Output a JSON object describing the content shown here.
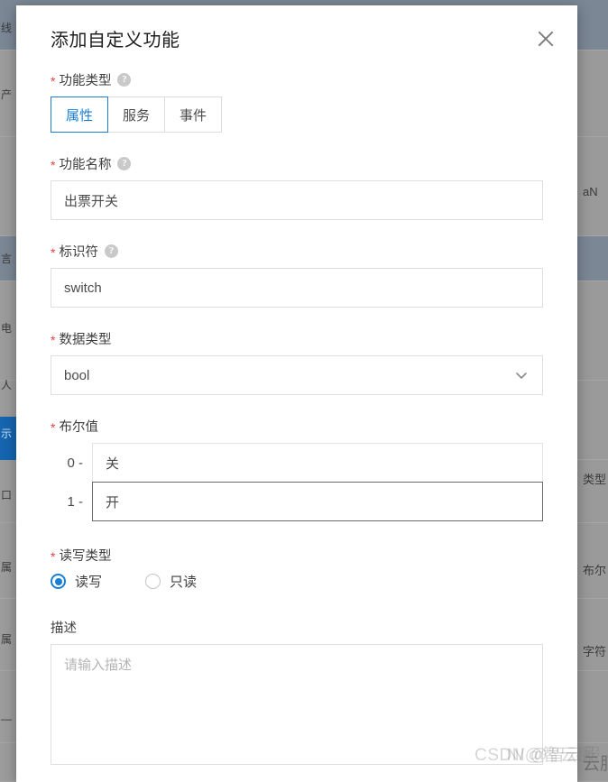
{
  "dialog": {
    "title": "添加自定义功能",
    "close_label": "×"
  },
  "fields": {
    "function_type": {
      "label": "功能类型",
      "required": true,
      "help": "?",
      "options": [
        "属性",
        "服务",
        "事件"
      ],
      "selected": "属性"
    },
    "function_name": {
      "label": "功能名称",
      "required": true,
      "help": "?",
      "value": "出票开关",
      "placeholder": ""
    },
    "identifier": {
      "label": "标识符",
      "required": true,
      "help": "?",
      "value": "switch",
      "placeholder": ""
    },
    "data_type": {
      "label": "数据类型",
      "required": true,
      "value": "bool",
      "options": [
        "bool"
      ]
    },
    "bool_values": {
      "label": "布尔值",
      "required": true,
      "rows": [
        {
          "key": "0 -",
          "value": "关",
          "focused": false
        },
        {
          "key": "1 -",
          "value": "开",
          "focused": true
        }
      ]
    },
    "rw_type": {
      "label": "读写类型",
      "required": true,
      "options": [
        {
          "label": "读写",
          "checked": true
        },
        {
          "label": "只读",
          "checked": false
        }
      ]
    },
    "description": {
      "label": "描述",
      "required": false,
      "value": "",
      "placeholder": "请输入描述"
    }
  },
  "watermark": {
    "text_a": "CSDN @智云服",
    "text_b": "N/@智云服"
  },
  "background": {
    "left_column_texts": [
      "线",
      "产",
      "言",
      "电",
      "人",
      "示",
      "口",
      "属",
      "属",
      "—"
    ],
    "right_column_texts": [
      "aN",
      "类型",
      "布尔",
      "字符",
      "云服"
    ]
  },
  "colors": {
    "accent": "#1a7fd4",
    "required_star": "#e8413c",
    "border": "#dedede",
    "text": "#4a4a4a",
    "placeholder": "#b4b4b4",
    "backdrop": "#9a9a9a"
  }
}
